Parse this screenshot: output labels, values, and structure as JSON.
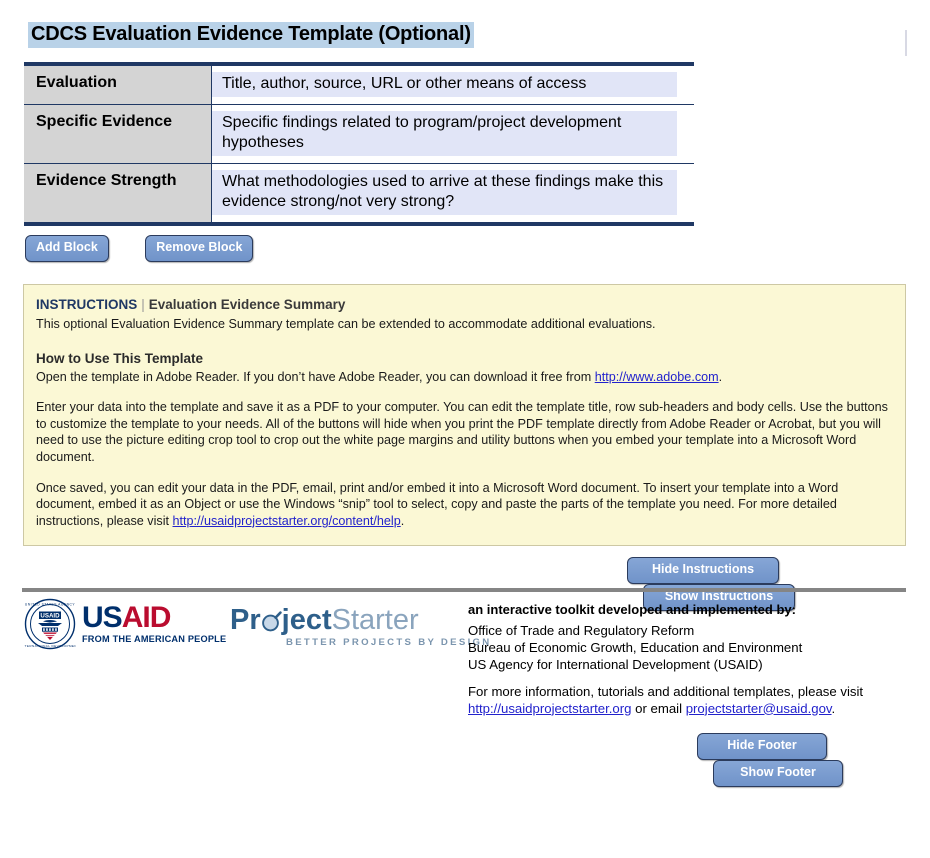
{
  "page": {
    "title": "CDCS Evaluation Evidence Template (Optional)"
  },
  "table": {
    "rows": [
      {
        "label": "Evaluation",
        "value": "Title, author, source, URL or other means of access"
      },
      {
        "label": "Specific Evidence",
        "value": "Specific findings related to program/project development hypotheses"
      },
      {
        "label": "Evidence Strength",
        "value": "What methodologies used to arrive at these findings make this evidence strong/not very strong?"
      }
    ]
  },
  "block_buttons": {
    "add": "Add Block",
    "remove": "Remove Block"
  },
  "instructions": {
    "keyword": "INSTRUCTIONS",
    "separator": "|",
    "subtitle": "Evaluation Evidence Summary",
    "intro": "This optional Evaluation Evidence Summary template can be extended to accommodate additional evaluations.",
    "how_to_heading": "How to Use This Template",
    "para1_before": "Open the template in Adobe Reader. If you don’t have Adobe Reader, you can download it free from ",
    "para1_link": "http://www.adobe.com",
    "para1_after": ".",
    "para2": "Enter your data into the template and save it as a PDF to your computer. You can edit the template title, row sub-headers and body cells. Use the buttons to customize the template to your needs. All of the buttons will hide when you print the PDF template directly from Adobe Reader or Acrobat, but you will need to use the picture editing crop tool to crop out the white page margins and utility buttons when you embed your template into a Microsoft Word document.",
    "para3_before": "Once saved, you can edit your data in the PDF, email, print and/or embed it into a Microsoft Word document. To insert your template into a Word document, embed it as an Object or use the Windows “snip” tool to select, copy and paste the parts of the template you need. For more detailed instructions, please visit ",
    "para3_link": "http://usaidprojectstarter.org/content/help",
    "para3_after": ".",
    "hide_button": "Hide Instructions",
    "show_button": "Show Instructions"
  },
  "footer": {
    "usaid_logo": {
      "us": "US",
      "aid": "AID",
      "tagline": "FROM THE AMERICAN PEOPLE",
      "seal_text": "USAID"
    },
    "projectstarter_logo": {
      "part1": "Pr",
      "part2": "ject",
      "part3": "Starter",
      "tagline": "BETTER PROJECTS BY DESIGN"
    },
    "headline": "an interactive toolkit developed and implemented by:",
    "org_lines": [
      "Office of Trade and Regulatory Reform",
      "Bureau of Economic Growth, Education and Environment",
      "US Agency for International Development (USAID)"
    ],
    "contact_before": "For more information, tutorials and additional templates, please visit ",
    "contact_link_site": "http://usaidprojectstarter.org",
    "contact_mid": " or email ",
    "contact_link_email": "projectstarter@usaid.gov",
    "contact_after": ".",
    "hide_button": "Hide Footer",
    "show_button": "Show Footer"
  },
  "colors": {
    "title_highlight": "#b9d2e8",
    "table_border": "#1f3864",
    "label_cell": "#d4d4d4",
    "field_cell": "#e1e5f7",
    "button_blue": "#7b9ed1",
    "instructions_bg": "#fbf8d5",
    "usaid_blue": "#002f6c",
    "usaid_red": "#ba0c2f",
    "link": "#2222cc"
  }
}
